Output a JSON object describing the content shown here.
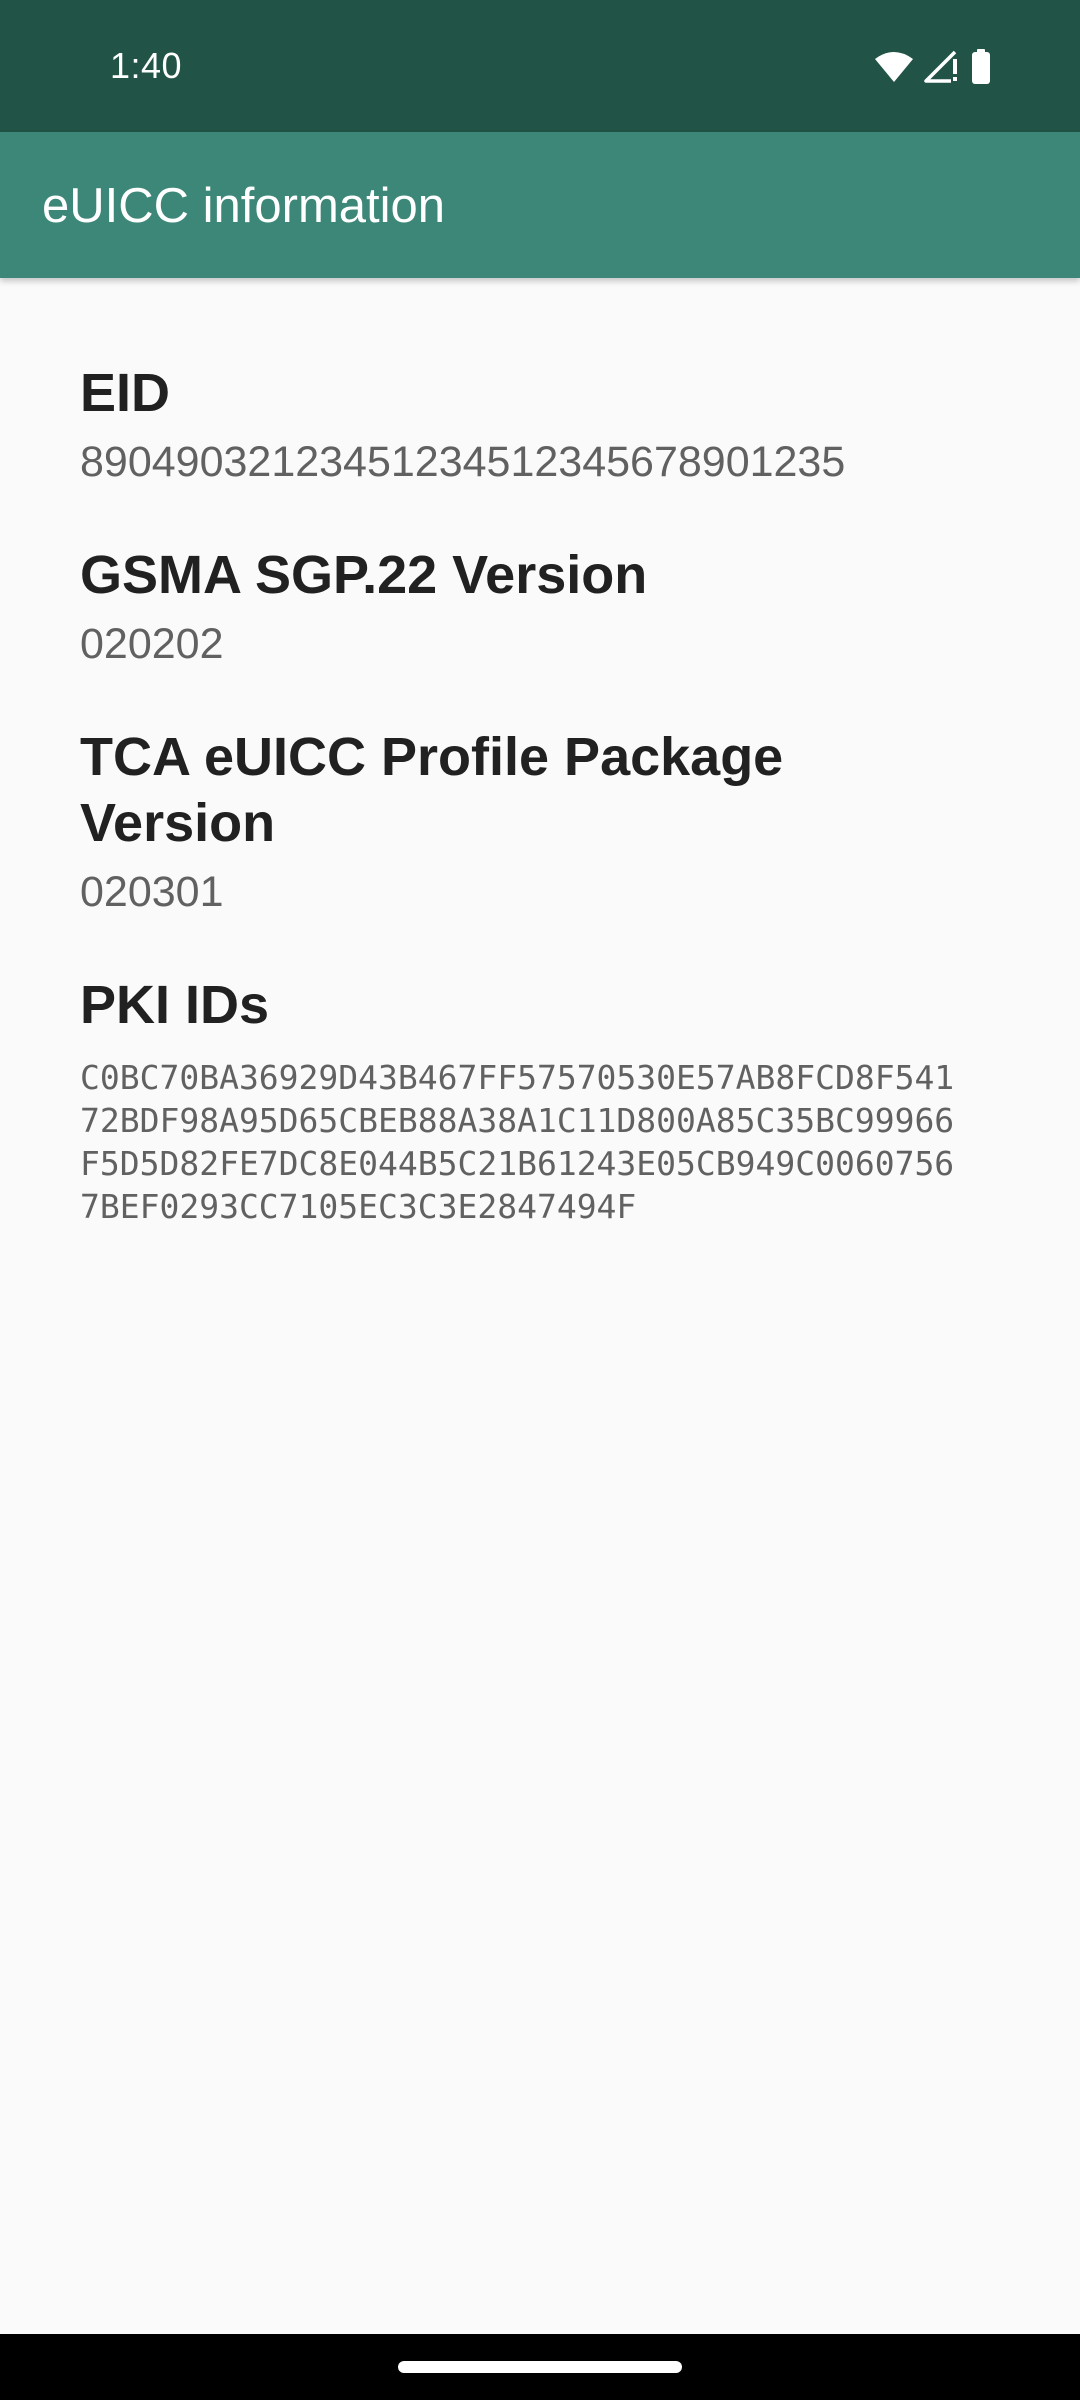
{
  "status_bar": {
    "time": "1:40",
    "icons": [
      "wifi-icon",
      "signal-icon",
      "battery-icon"
    ]
  },
  "app_bar": {
    "title": "eUICC information"
  },
  "sections": [
    {
      "title": "EID",
      "value": "89049032123451234512345678901235"
    },
    {
      "title": "GSMA SGP.22 Version",
      "value": "020202"
    },
    {
      "title": "TCA eUICC Profile Package Version",
      "value": "020301"
    },
    {
      "title": "PKI IDs",
      "value": "C0BC70BA36929D43B467FF57570530E57AB8FCD8F54172BDF98A95D65CBEB88A38A1C11D800A85C35BC99966F5D5D82FE7DC8E044B5C21B61243E05CB949C00607567BEF0293CC7105EC3C3E2847494F"
    }
  ],
  "colors": {
    "status_bar": "#215446",
    "app_bar": "#3d8778",
    "background": "#fafafa",
    "title_text": "#212121",
    "value_text": "#616161"
  }
}
